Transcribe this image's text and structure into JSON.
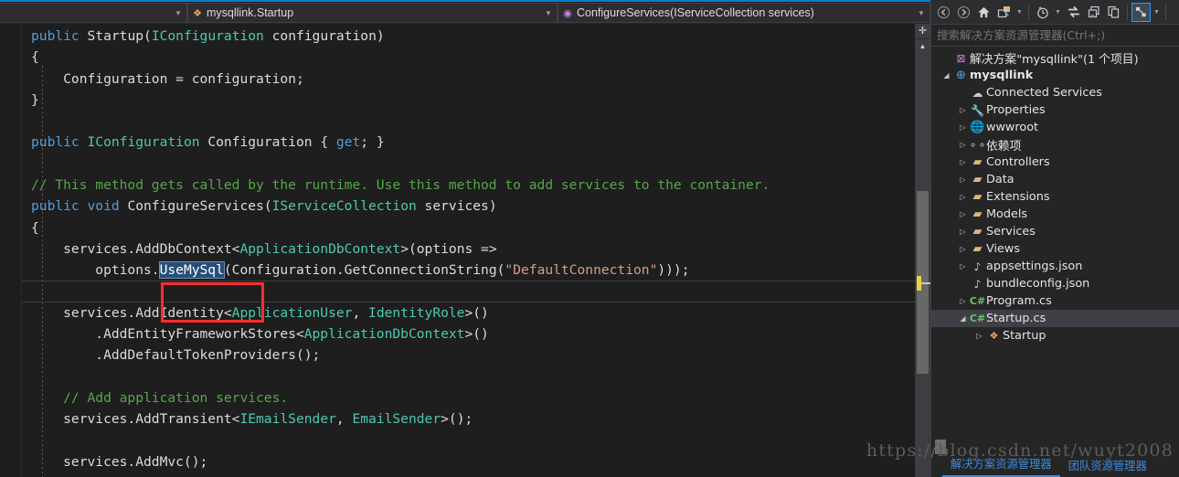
{
  "nav_bar": {
    "type_dropdown": {
      "label": "mysqllink.Startup",
      "icon": "class-icon"
    },
    "member_dropdown": {
      "label": "ConfigureServices(IServiceCollection services)",
      "icon": "method-icon"
    }
  },
  "editor": {
    "lines": [
      [
        {
          "t": "public ",
          "c": "kw"
        },
        {
          "t": "Startup",
          "c": "plain"
        },
        {
          "t": "(",
          "c": "plain"
        },
        {
          "t": "IConfiguration",
          "c": "type"
        },
        {
          "t": " configuration)",
          "c": "plain"
        }
      ],
      [
        {
          "t": "{",
          "c": "plain"
        }
      ],
      [
        {
          "t": "    Configuration = configuration;",
          "c": "plain"
        }
      ],
      [
        {
          "t": "}",
          "c": "plain"
        }
      ],
      [
        {
          "t": "",
          "c": "plain"
        }
      ],
      [
        {
          "t": "public ",
          "c": "kw"
        },
        {
          "t": "IConfiguration",
          "c": "type"
        },
        {
          "t": " Configuration { ",
          "c": "plain"
        },
        {
          "t": "get",
          "c": "kw"
        },
        {
          "t": "; }",
          "c": "plain"
        }
      ],
      [
        {
          "t": "",
          "c": "plain"
        }
      ],
      [
        {
          "t": "// This method gets called by the runtime. Use this method to add services to the container.",
          "c": "cmt"
        }
      ],
      [
        {
          "t": "public ",
          "c": "kw"
        },
        {
          "t": "void ",
          "c": "kw"
        },
        {
          "t": "ConfigureServices(",
          "c": "plain"
        },
        {
          "t": "IServiceCollection",
          "c": "type"
        },
        {
          "t": " services)",
          "c": "plain"
        }
      ],
      [
        {
          "t": "{",
          "c": "plain"
        }
      ],
      [
        {
          "t": "    services.AddDbContext<",
          "c": "plain"
        },
        {
          "t": "ApplicationDbContext",
          "c": "type"
        },
        {
          "t": ">(options =>",
          "c": "plain"
        }
      ],
      [
        {
          "t": "        options.",
          "c": "plain"
        },
        {
          "t": "UseMySql",
          "c": "sel"
        },
        {
          "t": "(Configuration.GetConnectionString(",
          "c": "plain"
        },
        {
          "t": "\"DefaultConnection\"",
          "c": "str"
        },
        {
          "t": ")));",
          "c": "plain"
        }
      ],
      [
        {
          "t": "",
          "c": "plain"
        }
      ],
      [
        {
          "t": "    services.AddIdentity<",
          "c": "plain"
        },
        {
          "t": "ApplicationUser",
          "c": "type"
        },
        {
          "t": ", ",
          "c": "plain"
        },
        {
          "t": "IdentityRole",
          "c": "type"
        },
        {
          "t": ">()",
          "c": "plain"
        }
      ],
      [
        {
          "t": "        .AddEntityFrameworkStores<",
          "c": "plain"
        },
        {
          "t": "ApplicationDbContext",
          "c": "type"
        },
        {
          "t": ">()",
          "c": "plain"
        }
      ],
      [
        {
          "t": "        .AddDefaultTokenProviders();",
          "c": "plain"
        }
      ],
      [
        {
          "t": "",
          "c": "plain"
        }
      ],
      [
        {
          "t": "    // Add application services.",
          "c": "cmt"
        }
      ],
      [
        {
          "t": "    services.AddTransient<",
          "c": "plain"
        },
        {
          "t": "IEmailSender",
          "c": "type"
        },
        {
          "t": ", ",
          "c": "plain"
        },
        {
          "t": "EmailSender",
          "c": "type"
        },
        {
          "t": ">();",
          "c": "plain"
        }
      ],
      [
        {
          "t": "",
          "c": "plain"
        }
      ],
      [
        {
          "t": "    services.AddMvc();",
          "c": "plain"
        }
      ]
    ],
    "selected_text": "UseMySql",
    "annotation": {
      "shape": "rectangle",
      "color": "#ff2d2d",
      "target": "UseMySql"
    }
  },
  "solution_explorer": {
    "toolbar": [
      {
        "name": "back-button",
        "icon": "arrow-left-icon"
      },
      {
        "name": "forward-button",
        "icon": "arrow-right-icon"
      },
      {
        "name": "home-button",
        "icon": "home-icon"
      },
      {
        "name": "sync-with-active-document-button",
        "icon": "sync-folder-icon"
      },
      {
        "name": "pending-changes-filter-button",
        "icon": "clock-icon"
      },
      {
        "name": "refresh-button",
        "icon": "refresh-icon"
      },
      {
        "name": "collapse-all-button",
        "icon": "collapse-all-icon"
      },
      {
        "name": "show-all-files-button",
        "icon": "copy-files-icon"
      },
      {
        "name": "properties-button",
        "icon": "track-active-item-icon"
      }
    ],
    "search": {
      "placeholder": "搜索解决方案资源管理器(Ctrl+;)",
      "value": ""
    },
    "tree": [
      {
        "label": "解决方案\"mysqllink\"(1 个项目)",
        "icon": "solution-icon",
        "indent": 0,
        "expander": "none",
        "bold": false,
        "selected": false
      },
      {
        "label": "mysqllink",
        "icon": "project-web-icon",
        "indent": 0,
        "expander": "expanded",
        "bold": true,
        "selected": false
      },
      {
        "label": "Connected Services",
        "icon": "cloud-icon",
        "indent": 1,
        "expander": "none",
        "bold": false,
        "selected": false
      },
      {
        "label": "Properties",
        "icon": "wrench-icon",
        "indent": 1,
        "expander": "collapsed",
        "bold": false,
        "selected": false
      },
      {
        "label": "wwwroot",
        "icon": "globe-icon",
        "indent": 1,
        "expander": "collapsed",
        "bold": false,
        "selected": false
      },
      {
        "label": "依赖项",
        "icon": "dependencies-icon",
        "indent": 1,
        "expander": "collapsed",
        "bold": false,
        "selected": false
      },
      {
        "label": "Controllers",
        "icon": "folder-icon",
        "indent": 1,
        "expander": "collapsed",
        "bold": false,
        "selected": false
      },
      {
        "label": "Data",
        "icon": "folder-icon",
        "indent": 1,
        "expander": "collapsed",
        "bold": false,
        "selected": false
      },
      {
        "label": "Extensions",
        "icon": "folder-icon",
        "indent": 1,
        "expander": "collapsed",
        "bold": false,
        "selected": false
      },
      {
        "label": "Models",
        "icon": "folder-icon",
        "indent": 1,
        "expander": "collapsed",
        "bold": false,
        "selected": false
      },
      {
        "label": "Services",
        "icon": "folder-icon",
        "indent": 1,
        "expander": "collapsed",
        "bold": false,
        "selected": false
      },
      {
        "label": "Views",
        "icon": "folder-icon",
        "indent": 1,
        "expander": "collapsed",
        "bold": false,
        "selected": false
      },
      {
        "label": "appsettings.json",
        "icon": "json-icon",
        "indent": 1,
        "expander": "collapsed",
        "bold": false,
        "selected": false
      },
      {
        "label": "bundleconfig.json",
        "icon": "json-icon",
        "indent": 1,
        "expander": "none",
        "bold": false,
        "selected": false
      },
      {
        "label": "Program.cs",
        "icon": "csharp-icon",
        "indent": 1,
        "expander": "collapsed",
        "bold": false,
        "selected": false
      },
      {
        "label": "Startup.cs",
        "icon": "csharp-icon",
        "indent": 1,
        "expander": "expanded",
        "bold": false,
        "selected": true
      },
      {
        "label": "Startup",
        "icon": "class-icon",
        "indent": 2,
        "expander": "collapsed",
        "bold": false,
        "selected": false
      }
    ],
    "tabs": [
      {
        "label": "解决方案资源管理器",
        "active": true
      },
      {
        "label": "团队资源管理器",
        "active": false
      }
    ]
  },
  "watermark": {
    "text": "https://blog.csdn.net/wuyt2008"
  },
  "colors": {
    "accent": "#007acc",
    "selection": "#264f78",
    "annotation": "#ff2d2d",
    "keyword": "#569cd6",
    "type": "#4ec9b0",
    "comment": "#57a64a",
    "string": "#d69d85"
  }
}
